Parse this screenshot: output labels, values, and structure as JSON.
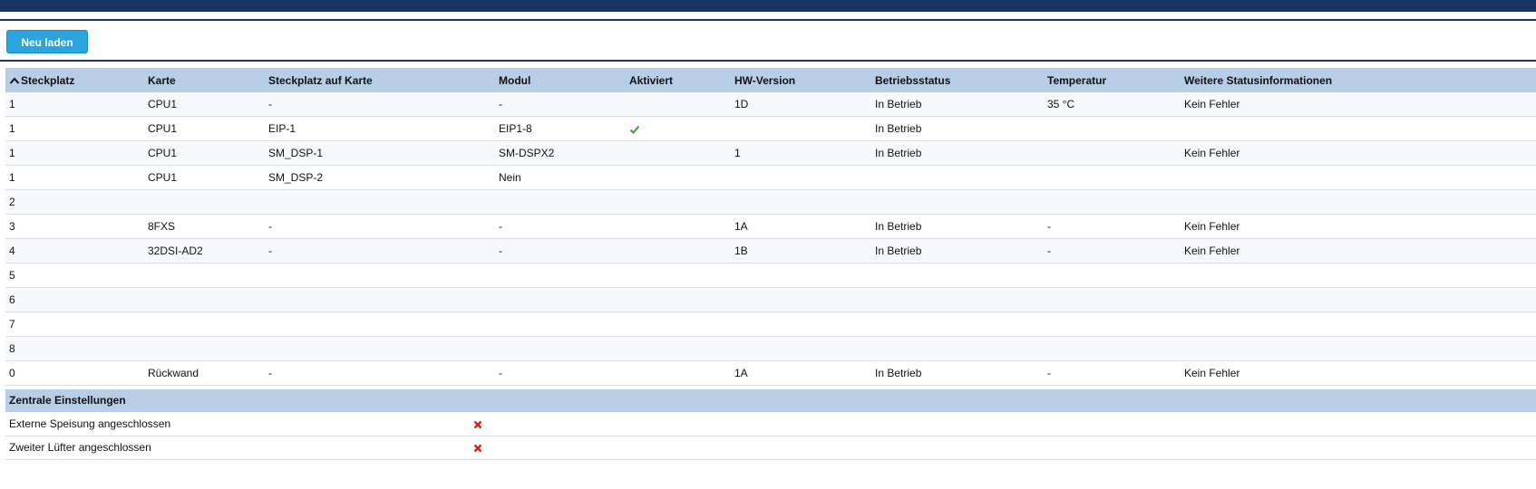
{
  "toolbar": {
    "reload_label": "Neu laden"
  },
  "table": {
    "sort_column": "Steckplatz",
    "sort_direction": "ascending",
    "columns": [
      "Steckplatz",
      "Karte",
      "Steckplatz auf Karte",
      "Modul",
      "Aktiviert",
      "HW-Version",
      "Betriebsstatus",
      "Temperatur",
      "Weitere Statusinformationen"
    ],
    "rows": [
      {
        "steckplatz": "1",
        "karte": "CPU1",
        "steckplatz_karte": "-",
        "modul": "-",
        "aktiviert": "",
        "hw": "1D",
        "status": "In Betrieb",
        "temp": "35 °C",
        "info": "Kein Fehler"
      },
      {
        "steckplatz": "1",
        "karte": "CPU1",
        "steckplatz_karte": "EIP-1",
        "modul": "EIP1-8",
        "aktiviert": "check",
        "hw": "",
        "status": "In Betrieb",
        "temp": "",
        "info": ""
      },
      {
        "steckplatz": "1",
        "karte": "CPU1",
        "steckplatz_karte": "SM_DSP-1",
        "modul": "SM-DSPX2",
        "aktiviert": "",
        "hw": "1",
        "status": "In Betrieb",
        "temp": "",
        "info": "Kein Fehler"
      },
      {
        "steckplatz": "1",
        "karte": "CPU1",
        "steckplatz_karte": "SM_DSP-2",
        "modul": "Nein",
        "aktiviert": "",
        "hw": "",
        "status": "",
        "temp": "",
        "info": ""
      },
      {
        "steckplatz": "2",
        "karte": "",
        "steckplatz_karte": "",
        "modul": "",
        "aktiviert": "",
        "hw": "",
        "status": "",
        "temp": "",
        "info": ""
      },
      {
        "steckplatz": "3",
        "karte": "8FXS",
        "steckplatz_karte": "-",
        "modul": "-",
        "aktiviert": "",
        "hw": "1A",
        "status": "In Betrieb",
        "temp": "-",
        "info": "Kein Fehler"
      },
      {
        "steckplatz": "4",
        "karte": "32DSI-AD2",
        "steckplatz_karte": "-",
        "modul": "-",
        "aktiviert": "",
        "hw": "1B",
        "status": "In Betrieb",
        "temp": "-",
        "info": "Kein Fehler"
      },
      {
        "steckplatz": "5",
        "karte": "",
        "steckplatz_karte": "",
        "modul": "",
        "aktiviert": "",
        "hw": "",
        "status": "",
        "temp": "",
        "info": ""
      },
      {
        "steckplatz": "6",
        "karte": "",
        "steckplatz_karte": "",
        "modul": "",
        "aktiviert": "",
        "hw": "",
        "status": "",
        "temp": "",
        "info": ""
      },
      {
        "steckplatz": "7",
        "karte": "",
        "steckplatz_karte": "",
        "modul": "",
        "aktiviert": "",
        "hw": "",
        "status": "",
        "temp": "",
        "info": ""
      },
      {
        "steckplatz": "8",
        "karte": "",
        "steckplatz_karte": "",
        "modul": "",
        "aktiviert": "",
        "hw": "",
        "status": "",
        "temp": "",
        "info": ""
      },
      {
        "steckplatz": "0",
        "karte": "Rückwand",
        "steckplatz_karte": "-",
        "modul": "-",
        "aktiviert": "",
        "hw": "1A",
        "status": "In Betrieb",
        "temp": "-",
        "info": "Kein Fehler"
      }
    ]
  },
  "central": {
    "title": "Zentrale Einstellungen",
    "items": [
      {
        "label": "Externe Speisung angeschlossen",
        "value": "cross"
      },
      {
        "label": "Zweiter Lüfter angeschlossen",
        "value": "cross"
      }
    ]
  },
  "colors": {
    "header_bar": "#1b3563",
    "button": "#2aa3df",
    "table_header": "#b8cde6",
    "check": "#3a9a3a",
    "cross": "#d62020"
  }
}
